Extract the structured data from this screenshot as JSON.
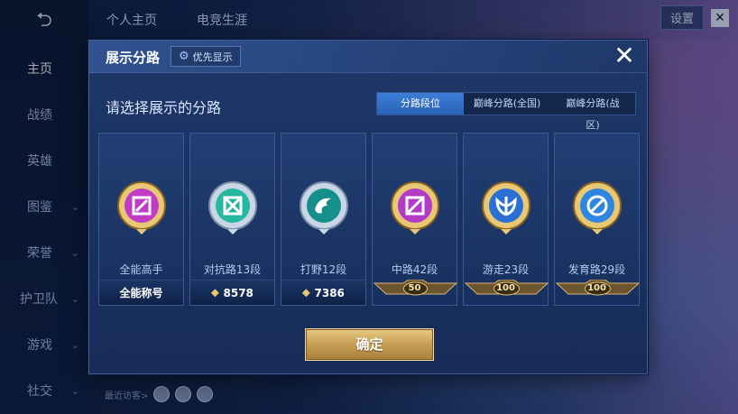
{
  "nav": {
    "back_icon": "back-arrow-icon",
    "items": [
      {
        "label": "主页",
        "active": true
      },
      {
        "label": "战绩"
      },
      {
        "label": "英雄"
      },
      {
        "label": "图鉴"
      },
      {
        "label": "荣誉"
      },
      {
        "label": "护卫队"
      },
      {
        "label": "游戏"
      },
      {
        "label": "社交"
      }
    ]
  },
  "top": {
    "tabs": [
      "个人主页",
      "电竞生涯"
    ],
    "settings_label": "设置"
  },
  "visitors": {
    "label": "最近访客>"
  },
  "modal": {
    "title": "展示分路",
    "priority_label": "优先显示",
    "subtitle": "请选择展示的分路",
    "segments": [
      "分路段位",
      "巅峰分路(全国)",
      "巅峰分路(战区)"
    ],
    "active_segment": 0,
    "cards": [
      {
        "label": "全能高手",
        "footer": "全能称号",
        "color": "#c23bc6"
      },
      {
        "label": "对抗路13段",
        "footer": "8578",
        "color": "#27b7a0"
      },
      {
        "label": "打野12段",
        "footer": "7386",
        "color": "#168e8a"
      },
      {
        "label": "中路42段",
        "rank": "50",
        "color": "#b43bc7"
      },
      {
        "label": "游走23段",
        "rank": "100",
        "color": "#2a6fd4"
      },
      {
        "label": "发育路29段",
        "rank": "100",
        "color": "#2d86e0"
      }
    ],
    "confirm_label": "确定"
  },
  "colors": {
    "accent_blue": "#3c7ed8",
    "gold": "#c79e55"
  }
}
